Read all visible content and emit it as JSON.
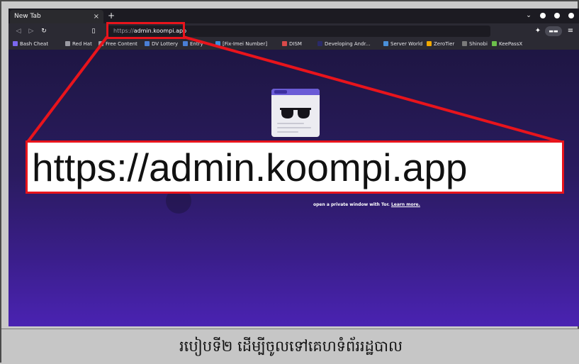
{
  "browser": {
    "tab": {
      "title": "New Tab",
      "close_glyph": "×"
    },
    "new_tab_glyph": "+",
    "window_controls": [
      "chevron-down-icon",
      "minimize-icon",
      "maximize-icon",
      "close-icon"
    ],
    "url": {
      "scheme": "https://",
      "host": "admin.koompi.app"
    },
    "bookmarks": [
      {
        "label": "Bash Cheat",
        "icon_color": "#7b68ee"
      },
      {
        "label": "Red Hat",
        "icon_color": "#9a9aa2"
      },
      {
        "label": "Free Content",
        "icon_color": "#9a9aa2"
      },
      {
        "label": "DV Lottery",
        "icon_color": "#4a7fd6"
      },
      {
        "label": "Entry",
        "icon_color": "#4a7fd6"
      },
      {
        "label": "[Fix-Imei Number]",
        "icon_color": "#3b8fe0"
      },
      {
        "label": "DISM",
        "icon_color": "#d94a4a"
      },
      {
        "label": "Developing Andr...",
        "icon_color": "#2a2a6a"
      },
      {
        "label": "Server World",
        "icon_color": "#4a90d9"
      },
      {
        "label": "ZeroTier",
        "icon_color": "#f2a900"
      },
      {
        "label": "Shinobi",
        "icon_color": "#7a7a7a"
      },
      {
        "label": "KeePassX",
        "icon_color": "#6cc04a"
      }
    ]
  },
  "private_page": {
    "message": "open a private window with Tor.",
    "learn_more": "Learn more."
  },
  "callout": {
    "text": "https://admin.koompi.app",
    "color": "#e8141c"
  },
  "caption": {
    "text": "របៀបទី២ ដើម្បីចូលទៅគេហទំព័ររដ្ឋបាល"
  }
}
